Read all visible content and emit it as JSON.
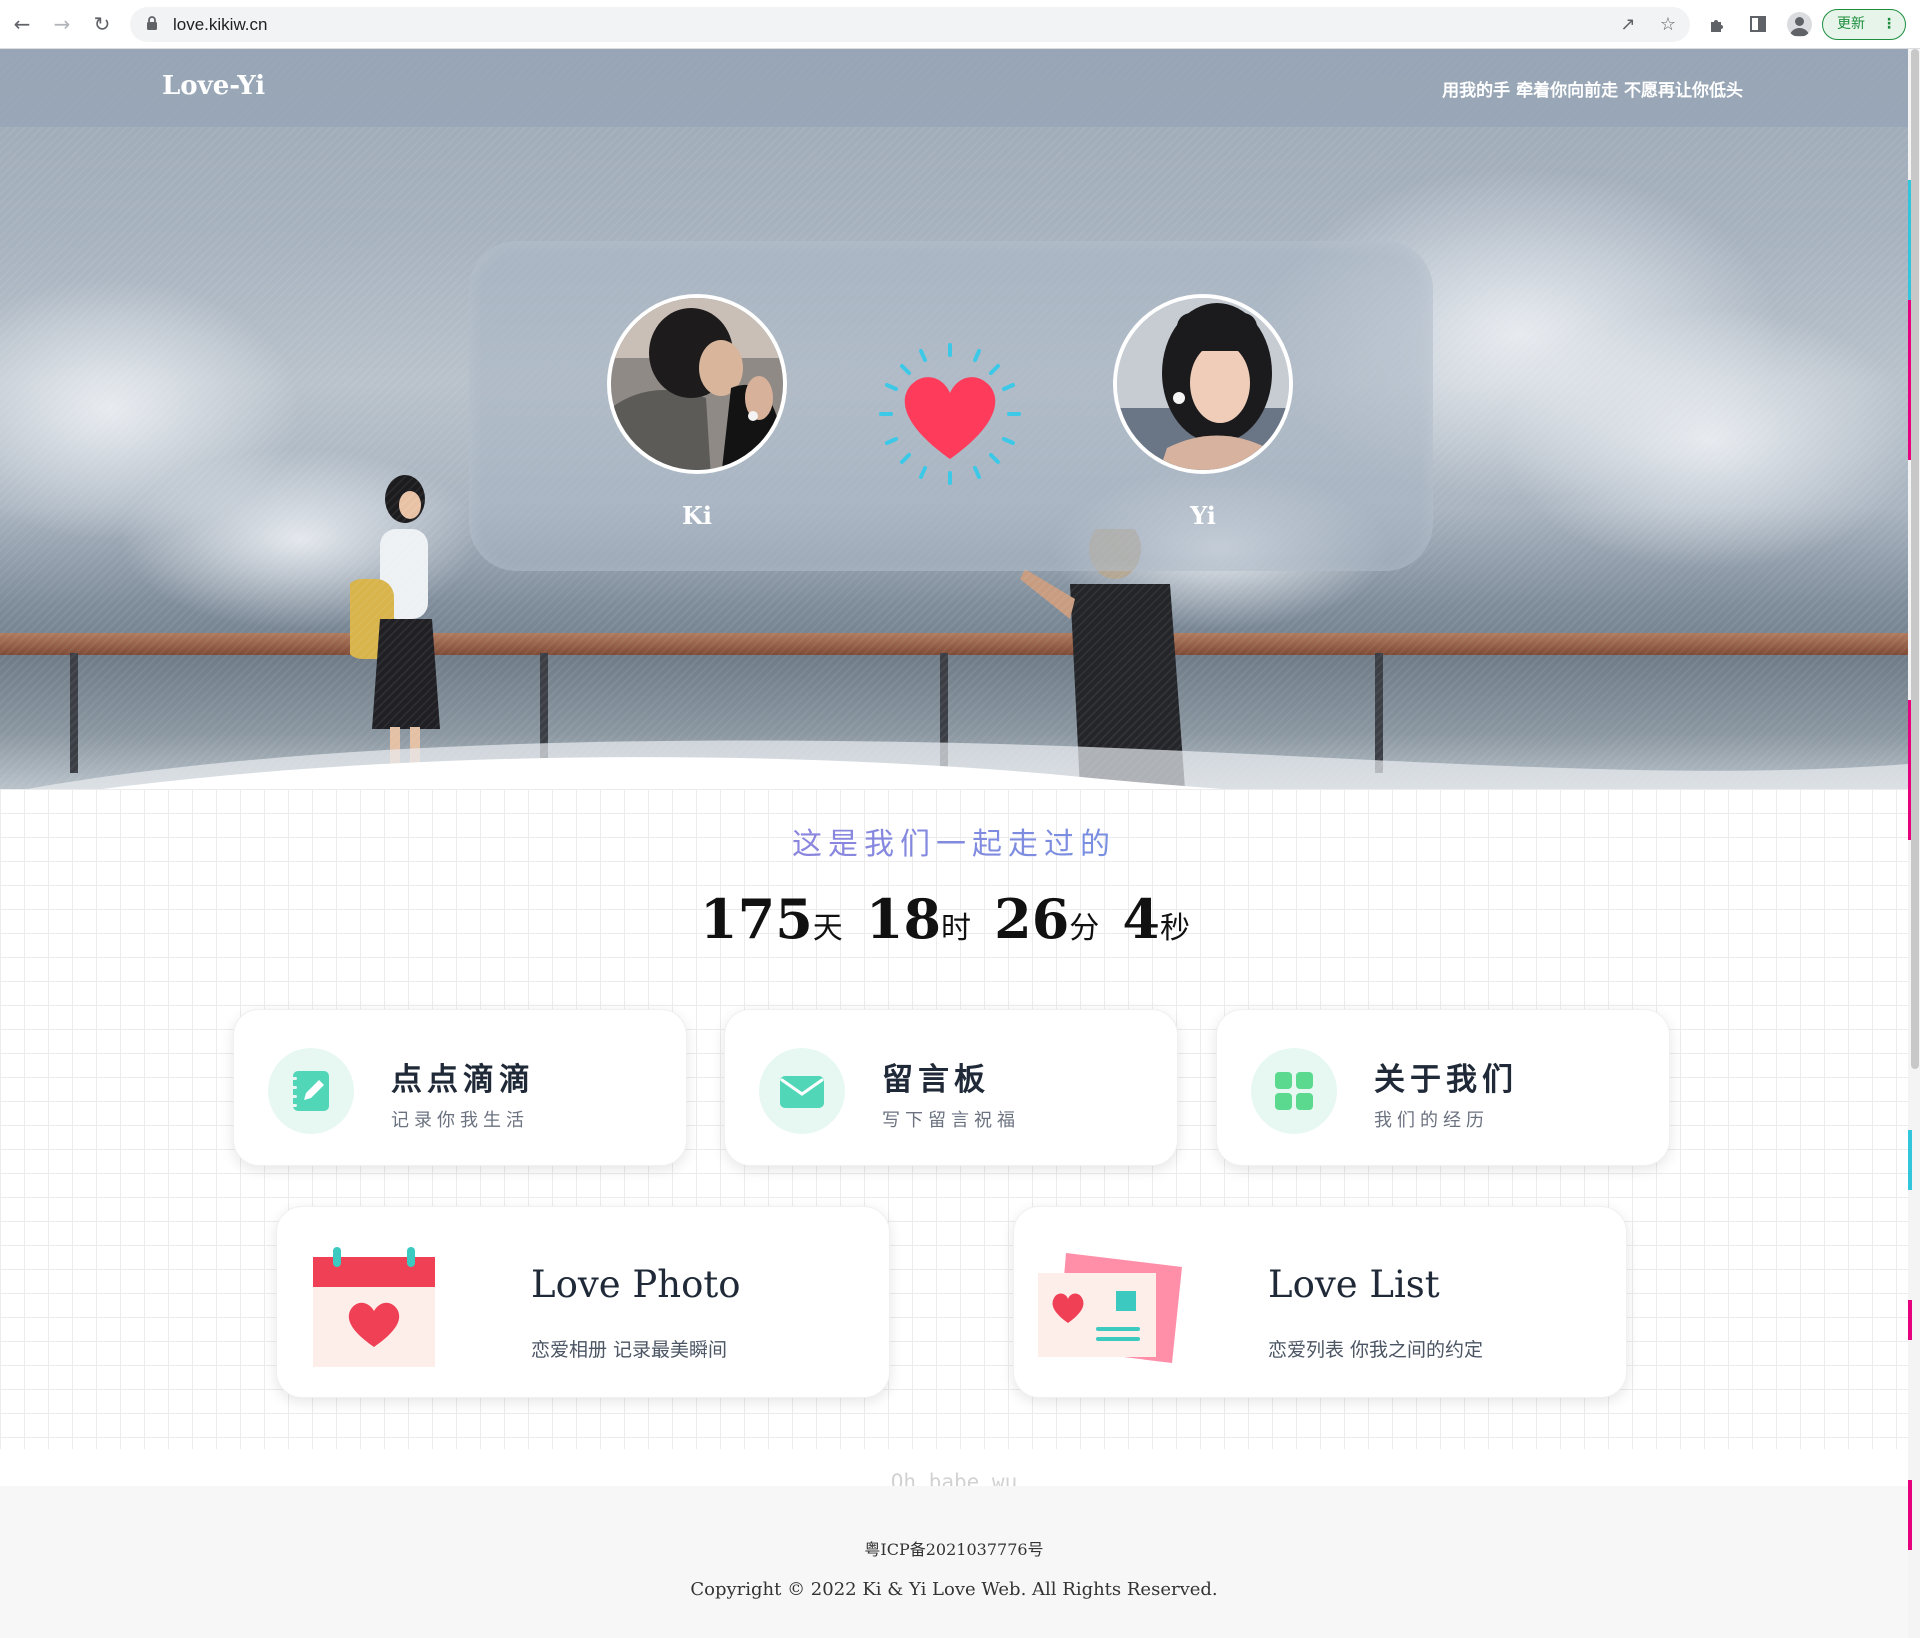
{
  "browser": {
    "url": "love.kikiw.cn",
    "update_label": "更新"
  },
  "nav": {
    "brand": "Love-Yi",
    "tagline": "用我的手 牵着你向前走 不愿再让你低头"
  },
  "couple": {
    "left_name": "Ki",
    "right_name": "Yi"
  },
  "together": {
    "heading": "这是我们一起走过的",
    "days": "175",
    "days_unit": "天",
    "hours": "18",
    "hours_unit": "时",
    "minutes": "26",
    "minutes_unit": "分",
    "seconds": "4",
    "seconds_unit": "秒"
  },
  "cards": [
    {
      "title": "点点滴滴",
      "subtitle": "记录你我生活",
      "icon": "notebook-edit-icon"
    },
    {
      "title": "留言板",
      "subtitle": "写下留言祝福",
      "icon": "envelope-icon"
    },
    {
      "title": "关于我们",
      "subtitle": "我们的经历",
      "icon": "grid-icon"
    }
  ],
  "big_cards": [
    {
      "title": "Love Photo",
      "subtitle": "恋爱相册 记录最美瞬间",
      "icon": "calendar-heart-icon"
    },
    {
      "title": "Love List",
      "subtitle": "恋爱列表 你我之间的约定",
      "icon": "card-heart-icon"
    }
  ],
  "footer": {
    "babe": "Oh babe wu",
    "icp": "粤ICP备2021037776号",
    "copyright": "Copyright © 2022 Ki & Yi Love Web. All Rights Reserved."
  },
  "colors": {
    "heart": "#ff3b5c",
    "heart_rays": "#3cc9e8",
    "mint_icon": "#52d6b8",
    "green_icon": "#5bd98e",
    "calendar_red": "#ef4056"
  }
}
